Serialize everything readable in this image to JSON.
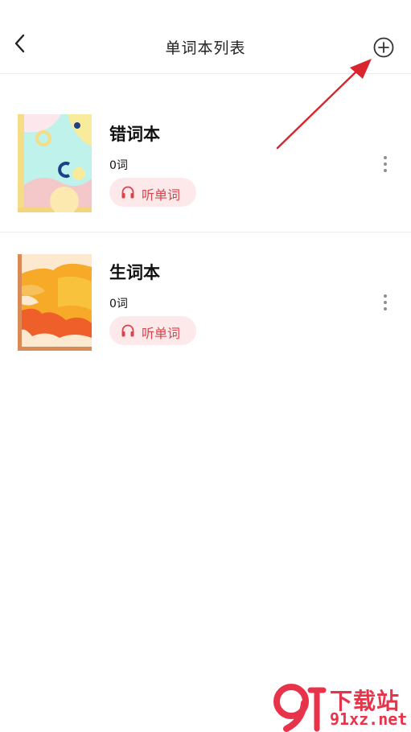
{
  "header": {
    "title": "单词本列表",
    "back_icon": "chevron-left-icon",
    "add_icon": "plus-circle-icon"
  },
  "books": [
    {
      "name": "错词本",
      "count": "0词",
      "listen_label": "听单词",
      "cover": "pastel-shapes-cover"
    },
    {
      "name": "生词本",
      "count": "0词",
      "listen_label": "听单词",
      "cover": "orange-flame-cover"
    }
  ],
  "colors": {
    "accent": "#d8434b",
    "listen_bg": "#fde9ea",
    "annotation_arrow": "#d9252e"
  },
  "watermark": {
    "title": "下载站",
    "domain": "91xz.net"
  }
}
